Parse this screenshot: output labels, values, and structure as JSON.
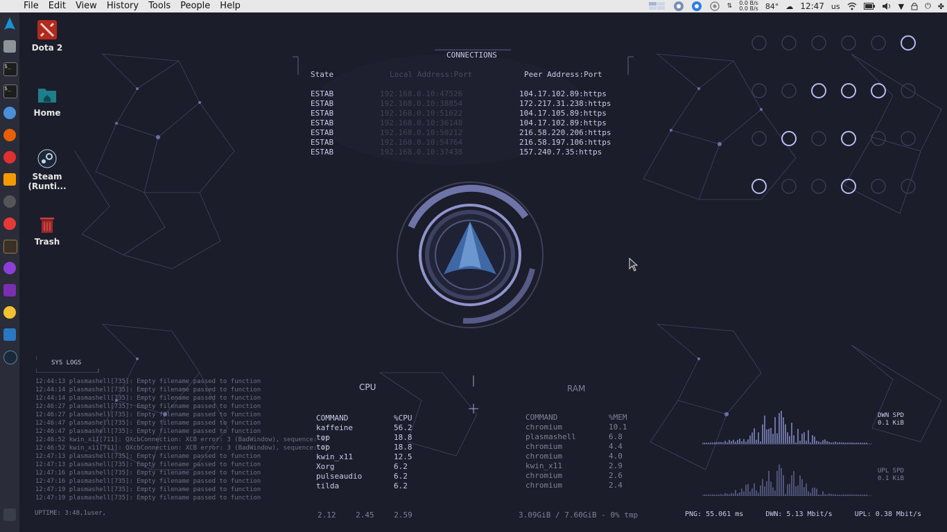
{
  "menu": {
    "items": [
      "File",
      "Edit",
      "View",
      "History",
      "Tools",
      "People",
      "Help"
    ]
  },
  "tray": {
    "net_up": "0.0 B/s",
    "net_down": "0.0 B/s",
    "temp": "84°",
    "time": "12:47",
    "keyboard": "us"
  },
  "desktop": {
    "icons": [
      {
        "label": "Dota 2",
        "icon": "dota-icon"
      },
      {
        "label": "Home",
        "icon": "home-folder-icon"
      },
      {
        "label": "Steam (Runti...",
        "icon": "steam-icon"
      },
      {
        "label": "Trash",
        "icon": "trash-icon"
      }
    ]
  },
  "connections": {
    "title": "CONNECTIONS",
    "headers": {
      "state": "State",
      "local": "Local Address:Port",
      "peer": "Peer Address:Port"
    },
    "rows": [
      {
        "state": "ESTAB",
        "local": "192.168.0.10:47526",
        "peer": "104.17.102.89:https"
      },
      {
        "state": "ESTAB",
        "local": "192.168.0.10:38854",
        "peer": "172.217.31.238:https"
      },
      {
        "state": "ESTAB",
        "local": "192.168.0.10:51622",
        "peer": "104.17.105.89:https"
      },
      {
        "state": "ESTAB",
        "local": "192.168.0.10:36148",
        "peer": "104.17.102.89:https"
      },
      {
        "state": "ESTAB",
        "local": "192.168.0.10:50212",
        "peer": "216.58.220.206:https"
      },
      {
        "state": "ESTAB",
        "local": "192.168.0.10:54764",
        "peer": "216.58.197.106:https"
      },
      {
        "state": "ESTAB",
        "local": "192.168.0.10:37438",
        "peer": "157.240.7.35:https"
      }
    ]
  },
  "syslogs": {
    "title": "SYS LOGS",
    "lines": [
      "12:44:13  plasmashell[735]: Empty filename passed to function",
      "12:44:14  plasmashell[735]: Empty filename passed to function",
      "12:44:14  plasmashell[735]: Empty filename passed to function",
      "12:46:27  plasmashell[735]: Empty filename passed to function",
      "12:46:27  plasmashell[735]: Empty filename passed to function",
      "12:46:47  plasmashell[735]: Empty filename passed to function",
      "12:46:47  plasmashell[735]: Empty filename passed to function",
      "12:46:52  kwin_x11[711]: QXcbConnection: XCB error: 3 (BadWindow), sequence: 47",
      "12:46:52  kwin_x11[711]: QXcbConnection: XCB error: 3 (BadWindow), sequence: 47",
      "12:47:13  plasmashell[735]: Empty filename passed to function",
      "12:47:13  plasmashell[735]: Empty filename passed to function",
      "12:47:16  plasmashell[735]: Empty filename passed to function",
      "12:47:16  plasmashell[735]: Empty filename passed to function",
      "12:47:19  plasmashell[735]: Empty filename passed to function",
      "12:47:19  plasmashell[735]: Empty filename passed to function"
    ],
    "uptime": "UPTIME: 3:48,1user,"
  },
  "cpu": {
    "title": "CPU",
    "headers": {
      "command": "COMMAND",
      "pct": "%CPU"
    },
    "rows": [
      {
        "command": "kaffeine",
        "pct": "56.2"
      },
      {
        "command": "top",
        "pct": "18.8"
      },
      {
        "command": "top",
        "pct": "18.8"
      },
      {
        "command": "kwin_x11",
        "pct": "12.5"
      },
      {
        "command": "Xorg",
        "pct": "6.2"
      },
      {
        "command": "pulseaudio",
        "pct": "6.2"
      },
      {
        "command": "tilda",
        "pct": "6.2"
      }
    ],
    "loadavg": [
      "2.12",
      "2.45",
      "2.59"
    ]
  },
  "ram": {
    "title": "RAM",
    "headers": {
      "command": "COMMAND",
      "pct": "%MEM"
    },
    "rows": [
      {
        "command": "chromium",
        "pct": "10.1"
      },
      {
        "command": "plasmashell",
        "pct": "6.8"
      },
      {
        "command": "chromium",
        "pct": "4.4"
      },
      {
        "command": "chromium",
        "pct": "4.0"
      },
      {
        "command": "kwin_x11",
        "pct": "2.9"
      },
      {
        "command": "chromium",
        "pct": "2.6"
      },
      {
        "command": "chromium",
        "pct": "2.4"
      }
    ],
    "usage": "3.09GiB / 7.60GiB - 0% tmp"
  },
  "network": {
    "down_label": "DWN SPD",
    "down_value": "0.1 KiB",
    "up_label": "UPL SPD",
    "up_value": "0.1 KiB",
    "ping": "PNG: 55.061 ms",
    "down_rate": "DWN: 5.13 Mbit/s",
    "up_rate": "UPL: 0.38 Mbit/s"
  },
  "colors": {
    "accent": "#9aa0e6",
    "background": "#1b1d2b",
    "text": "#c7cbe8"
  }
}
